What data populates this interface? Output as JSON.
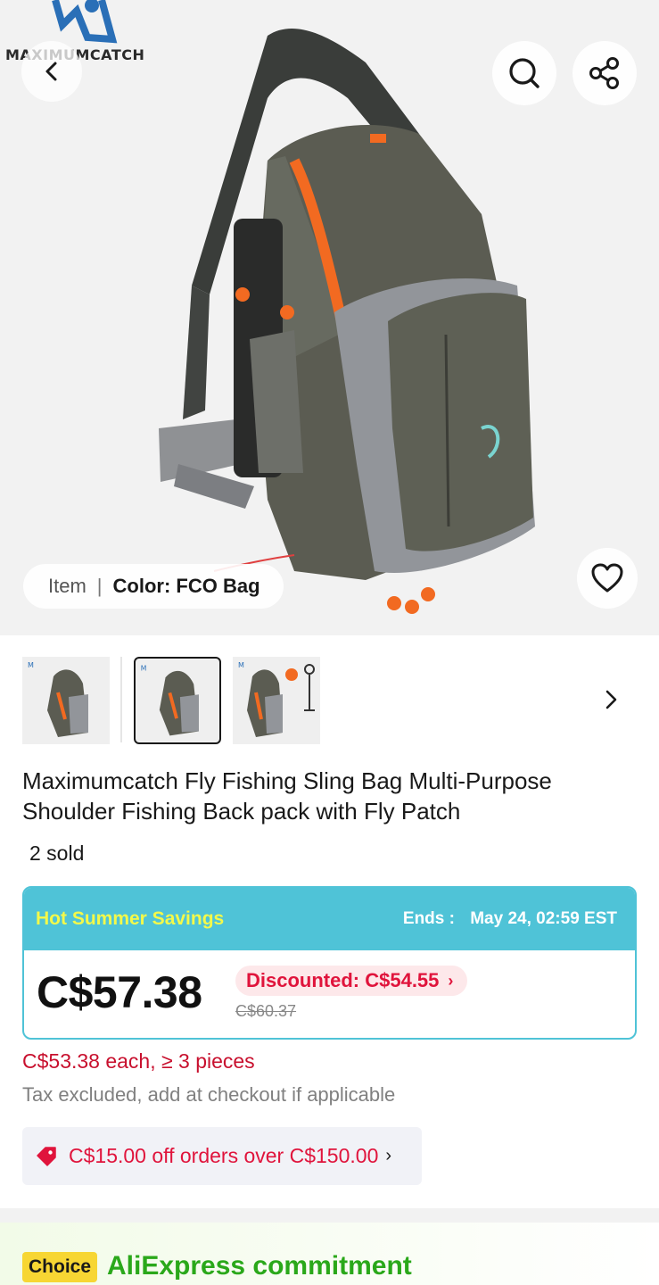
{
  "brand": {
    "logo_text": "MAXIMUMCATCH"
  },
  "hero": {
    "variant_item_label": "Item",
    "variant_separator": "|",
    "variant_color_label": "Color: FCO Bag"
  },
  "icons": {
    "back": "chevron-left-icon",
    "search": "search-icon",
    "share": "share-icon",
    "favorite": "heart-icon",
    "thumbs_next": "chevron-right-icon",
    "coupon": "tag-icon"
  },
  "product": {
    "title": "Maximumcatch Fly Fishing Sling Bag Multi-Purpose Shoulder Fishing Back pack with Fly Patch",
    "sold": "2 sold"
  },
  "promo": {
    "name": "Hot Summer Savings",
    "ends_label": "Ends :",
    "ends_value": "May 24, 02:59 EST",
    "price": "C$57.38",
    "discount": "Discounted: C$54.55",
    "discount_chevron": "›",
    "original_price": "C$60.37"
  },
  "bulk_price": "C$53.38 each, ≥ 3 pieces",
  "tax_note": "Tax excluded, add at checkout if applicable",
  "coupon": {
    "text": "C$15.00 off orders over C$150.00",
    "chevron": "›"
  },
  "choice": {
    "badge": "Choice",
    "title": "AliExpress commitment"
  },
  "colors": {
    "promo_accent": "#4fc3d7",
    "promo_name": "#f3f94a",
    "sale_red": "#e0143c",
    "choice_green": "#2aa81a",
    "choice_badge": "#f7d633"
  }
}
